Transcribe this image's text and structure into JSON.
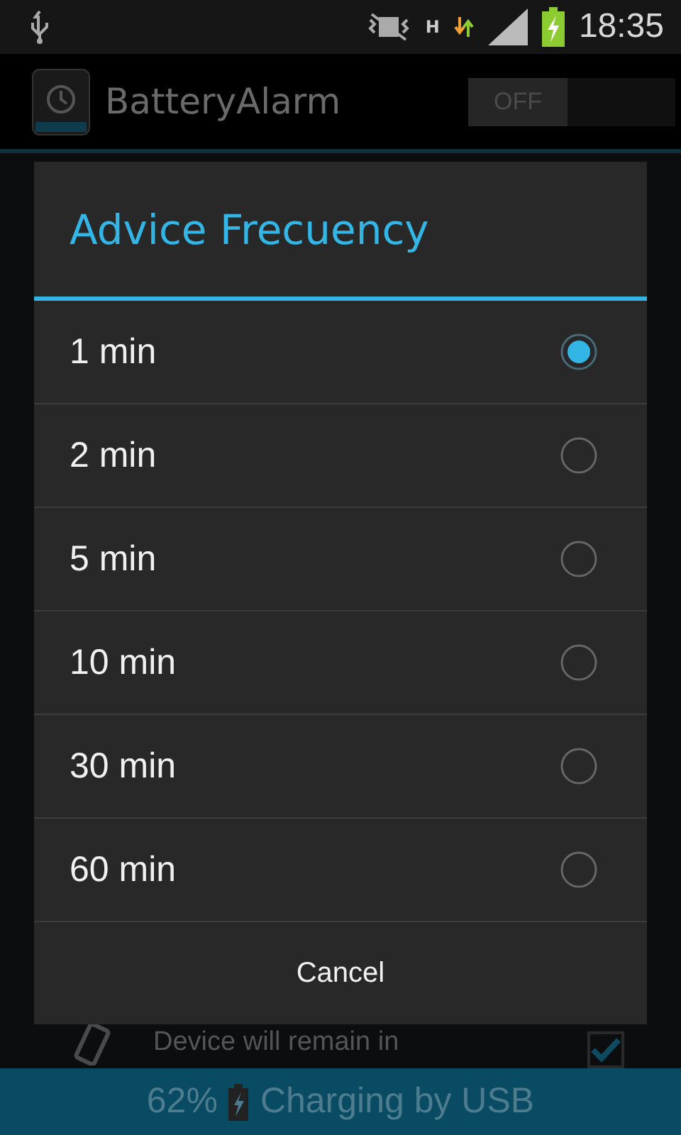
{
  "status_bar": {
    "time": "18:35",
    "network_type": "H"
  },
  "app_bar": {
    "title": "BatteryAlarm",
    "toggle": {
      "label": "OFF",
      "on": false
    }
  },
  "setting": {
    "description": "Device will remain in",
    "checked": true
  },
  "footer": {
    "percent": "62%",
    "text": "Charging by USB"
  },
  "dialog": {
    "title": "Advice Frecuency",
    "options": [
      {
        "label": "1 min",
        "selected": true
      },
      {
        "label": "2 min",
        "selected": false
      },
      {
        "label": "5 min",
        "selected": false
      },
      {
        "label": "10 min",
        "selected": false
      },
      {
        "label": "30 min",
        "selected": false
      },
      {
        "label": "60 min",
        "selected": false
      }
    ],
    "cancel": "Cancel"
  }
}
